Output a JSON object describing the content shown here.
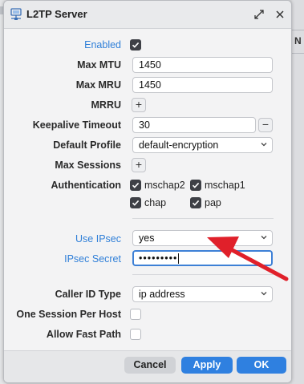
{
  "dialog": {
    "title": "L2TP Server"
  },
  "fields": {
    "enabled": {
      "label": "Enabled",
      "checked": true
    },
    "max_mtu": {
      "label": "Max MTU",
      "value": "1450"
    },
    "max_mru": {
      "label": "Max MRU",
      "value": "1450"
    },
    "mrru": {
      "label": "MRRU",
      "add": "+"
    },
    "keepalive": {
      "label": "Keepalive Timeout",
      "value": "30",
      "remove": "−"
    },
    "default_profile": {
      "label": "Default Profile",
      "value": "default-encryption"
    },
    "max_sessions": {
      "label": "Max Sessions",
      "add": "+"
    },
    "authentication": {
      "label": "Authentication",
      "options": [
        {
          "label": "mschap2",
          "checked": true
        },
        {
          "label": "mschap1",
          "checked": true
        },
        {
          "label": "chap",
          "checked": true
        },
        {
          "label": "pap",
          "checked": true
        }
      ]
    },
    "use_ipsec": {
      "label": "Use IPsec",
      "value": "yes"
    },
    "ipsec_secret": {
      "label": "IPsec Secret",
      "value": "•••••••••"
    },
    "caller_id_type": {
      "label": "Caller ID Type",
      "value": "ip address"
    },
    "one_session": {
      "label": "One Session Per Host",
      "checked": false
    },
    "fast_path": {
      "label": "Allow Fast Path",
      "checked": false
    }
  },
  "buttons": {
    "cancel": "Cancel",
    "apply": "Apply",
    "ok": "OK"
  },
  "background": {
    "right_number": "N"
  },
  "colors": {
    "accent": "#2f80e0",
    "label_blue": "#2f7fd8",
    "arrow": "#e0202a"
  }
}
